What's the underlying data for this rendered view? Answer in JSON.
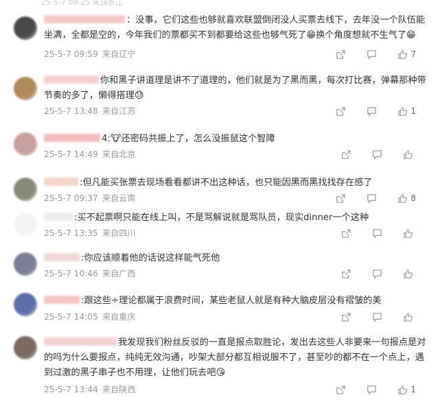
{
  "header": {
    "faded_text": "25-5-7 09:25 来自浙江"
  },
  "comments": [
    {
      "separator": "：",
      "text": "没事，它们这些也够就喜欢联盟倒闭没人买票去线下，去年没一个队伍能坐满，全都是空的，今年我们的票都买不到都要给这些也够气死了😁换个角度想就不生气了😁",
      "time": "25-5-7 09:59",
      "location": "来自辽宁",
      "likes": "7",
      "avatar_color": "#4a4a4a",
      "name_color": "#f3c9c9"
    },
    {
      "separator": "",
      "text": "你和黑子讲道理是讲不了道理的，他们就是为了黑而黑，每次打比赛，弹幕那种带节奏的多了，懒得搭理😓",
      "time": "25-5-7 13:48",
      "location": "来自江苏",
      "likes": "1",
      "avatar_color": "#b08a5c",
      "name_color": "#f5d0d0"
    },
    {
      "separator": "4:",
      "text": "🐮还密码共振上了，怎么没振鼠这个智障",
      "time": "25-5-7 14:49",
      "location": "来自北京",
      "likes": "",
      "avatar_color": "#c9a0a0",
      "name_color": "#f2bcbc"
    },
    {
      "separator": ":",
      "text": "但凡能买张票去现场看看都讲不出这种话，也只能因黑而黑找找存在感了",
      "time": "25-5-7 09:37",
      "location": "来自云南",
      "likes": "8",
      "avatar_color": "#8a8a7a",
      "name_color": "#f4d3c8"
    },
    {
      "separator": ":",
      "text": "买不起票啊只能在线上叫，不是骂解说就是骂队员，现实dinner一个这种",
      "time": "25-5-7 13:35",
      "location": "来自四川",
      "likes": "",
      "avatar_color": "#ffffff",
      "name_color": "#ededed"
    },
    {
      "separator": ":",
      "text": "你应该顺着他的话说这样能气死他",
      "time": "25-5-7 10:46",
      "location": "来自广西",
      "likes": "",
      "avatar_color": "#7a7f96",
      "name_color": "#f0d8d8"
    },
    {
      "separator": ":",
      "text": "跟这些÷理论都属于浪费时间，某些老鼠人就是有种大脑皮层没有褶皱的美",
      "time": "25-5-7 14:05",
      "location": "来自重庆",
      "likes": "",
      "avatar_color": "#5b6fa8",
      "name_color": "#f5c6c6"
    },
    {
      "separator": "",
      "text": "我发现我们粉丝反驳的一直是报点取胜论，发出去这些人非要来一句报点是对的吗为什么要报点，纯纯无效沟通，吵架大部分都互相说服不了，甚至吵的都不在一个点上，遇到过激的黑子串子也不用理，让他们玩去吧😘",
      "time": "25-5-7 13:44",
      "location": "来自陕西",
      "likes": "1",
      "avatar_color": "#7a6a62",
      "name_color": "#f4d2d2"
    }
  ],
  "icons": {
    "share": "share-icon",
    "comment": "comment-icon",
    "like": "like-icon"
  }
}
